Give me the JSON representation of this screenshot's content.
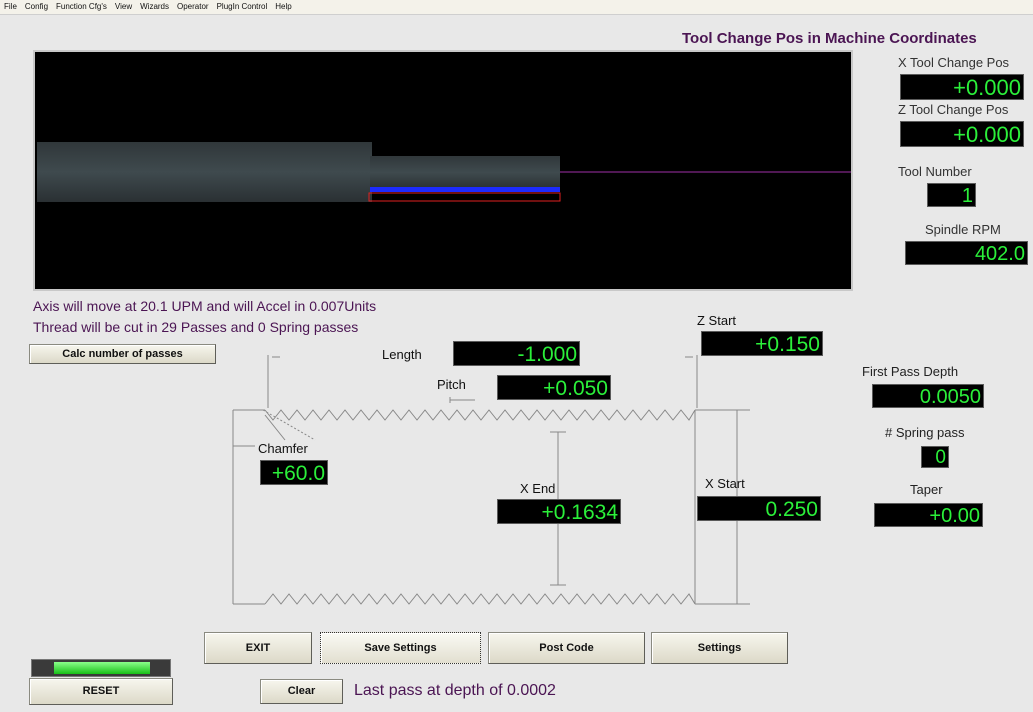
{
  "menu": [
    "File",
    "Config",
    "Function Cfg's",
    "View",
    "Wizards",
    "Operator",
    "PlugIn Control",
    "Help"
  ],
  "title": "Tool Change Pos in Machine Coordinates",
  "right_panel": {
    "x_tool_label": "X Tool Change Pos",
    "x_tool_value": "+0.000",
    "z_tool_label": "Z Tool Change Pos",
    "z_tool_value": "+0.000",
    "tool_number_label": "Tool Number",
    "tool_number_value": "1",
    "spindle_label": "Spindle RPM",
    "spindle_value": "402.0",
    "first_pass_label": "First Pass Depth",
    "first_pass_value": "0.0050",
    "spring_label": "# Spring pass",
    "spring_value": "0",
    "taper_label": "Taper",
    "taper_value": "+0.00"
  },
  "info": {
    "line1": "Axis will move at 20.1 UPM and will Accel in 0.007Units",
    "line2": "Thread will be cut in 29 Passes and 0 Spring passes"
  },
  "diagram": {
    "length_label": "Length",
    "length_value": "-1.000",
    "pitch_label": "Pitch",
    "pitch_value": "+0.050",
    "zstart_label": "Z Start",
    "zstart_value": "+0.150",
    "chamfer_label": "Chamfer",
    "chamfer_value": "+60.0",
    "xend_label": "X End",
    "xend_value": "+0.1634",
    "xstart_label": "X Start",
    "xstart_value": "0.250"
  },
  "buttons": {
    "calc": "Calc number of passes",
    "exit": "EXIT",
    "save": "Save Settings",
    "post": "Post Code",
    "settings": "Settings",
    "reset": "RESET",
    "clear": "Clear"
  },
  "status": "Last pass at depth of 0.0002",
  "colors": {
    "background": "#e8e8e8",
    "dro_text": "#2bf03a",
    "dro_bg": "#000000",
    "heading": "#4b1553",
    "reset_led": "#22d422"
  }
}
